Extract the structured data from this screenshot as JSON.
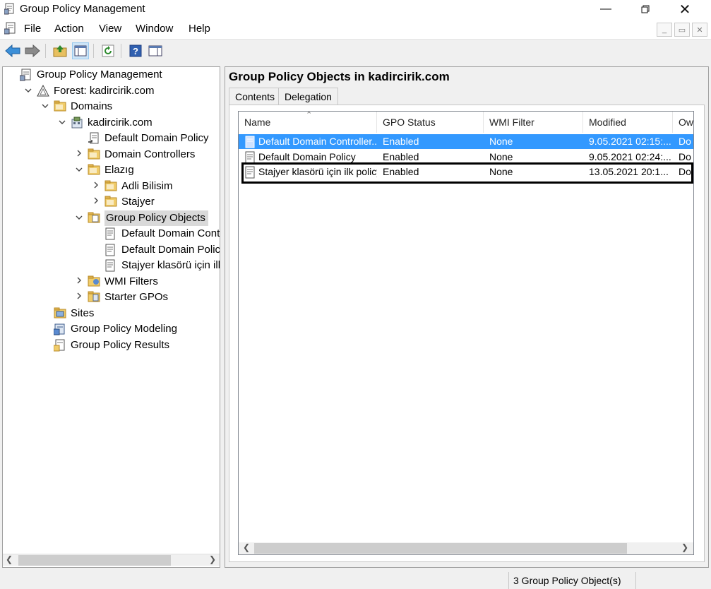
{
  "window": {
    "title": "Group Policy Management"
  },
  "menu": [
    "File",
    "Action",
    "View",
    "Window",
    "Help"
  ],
  "tree": [
    {
      "label": "Group Policy Management",
      "indent": 0,
      "expander": "",
      "icon": "gpm-icon"
    },
    {
      "label": "Forest: kadircirik.com",
      "indent": 1,
      "expander": "v",
      "icon": "forest-icon"
    },
    {
      "label": "Domains",
      "indent": 2,
      "expander": "v",
      "icon": "folder-icon"
    },
    {
      "label": "kadircirik.com",
      "indent": 3,
      "expander": "v",
      "icon": "domain-icon"
    },
    {
      "label": "Default Domain Policy",
      "indent": 4,
      "expander": "",
      "icon": "gpo-link-icon"
    },
    {
      "label": "Domain Controllers",
      "indent": 4,
      "expander": ">",
      "icon": "folder-icon"
    },
    {
      "label": "Elazıg",
      "indent": 4,
      "expander": "v",
      "icon": "folder-icon"
    },
    {
      "label": "Adli Bilisim",
      "indent": 5,
      "expander": ">",
      "icon": "folder-icon"
    },
    {
      "label": "Stajyer",
      "indent": 5,
      "expander": ">",
      "icon": "folder-icon"
    },
    {
      "label": "Group Policy Objects",
      "indent": 4,
      "expander": "v",
      "icon": "gpo-folder-icon",
      "selected": true
    },
    {
      "label": "Default Domain Control",
      "indent": 5,
      "expander": "",
      "icon": "gpo-icon"
    },
    {
      "label": "Default Domain Policy",
      "indent": 5,
      "expander": "",
      "icon": "gpo-icon"
    },
    {
      "label": "Stajyer klasörü için ilk pc",
      "indent": 5,
      "expander": "",
      "icon": "gpo-icon"
    },
    {
      "label": "WMI Filters",
      "indent": 4,
      "expander": ">",
      "icon": "wmi-folder-icon"
    },
    {
      "label": "Starter GPOs",
      "indent": 4,
      "expander": ">",
      "icon": "starter-gpo-icon"
    },
    {
      "label": "Sites",
      "indent": 2,
      "expander": "",
      "icon": "sites-icon"
    },
    {
      "label": "Group Policy Modeling",
      "indent": 2,
      "expander": "",
      "icon": "modeling-icon"
    },
    {
      "label": "Group Policy Results",
      "indent": 2,
      "expander": "",
      "icon": "results-icon"
    }
  ],
  "right": {
    "heading": "Group Policy Objects in kadircirik.com",
    "tabs": [
      "Contents",
      "Delegation"
    ],
    "columns": [
      "Name",
      "GPO Status",
      "WMI Filter",
      "Modified",
      "Ow"
    ],
    "rows": [
      [
        "Default Domain Controller...",
        "Enabled",
        "None",
        "9.05.2021 02:15:...",
        "Do"
      ],
      [
        "Default Domain Policy",
        "Enabled",
        "None",
        "9.05.2021 02:24:...",
        "Do"
      ],
      [
        "Stajyer klasörü için ilk policy",
        "Enabled",
        "None",
        "13.05.2021 20:1...",
        "Do"
      ]
    ]
  },
  "status": {
    "text": "3 Group Policy Object(s)"
  },
  "colors": {
    "selection": "#3399ff",
    "pressed": "#cce4f7"
  }
}
